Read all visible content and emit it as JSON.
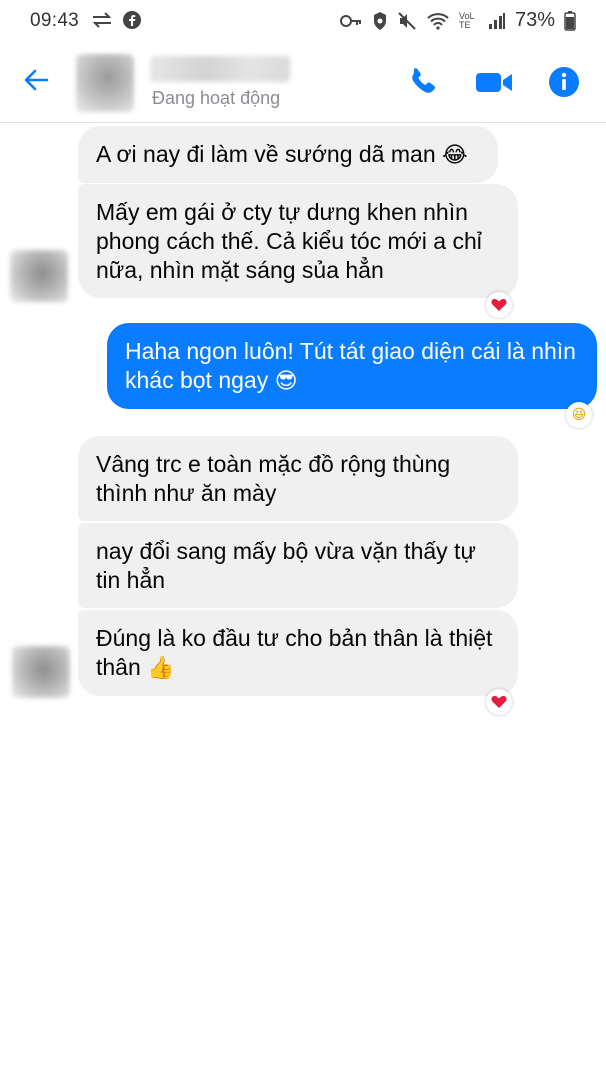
{
  "status_bar": {
    "time": "09:43",
    "battery": "73%",
    "network": "VoLTE",
    "icons": [
      "data-transfer-icon",
      "facebook-icon",
      "key-icon",
      "security-icon",
      "mute-icon",
      "wifi-icon",
      "signal-icon",
      "battery-icon"
    ]
  },
  "header": {
    "name": "",
    "status": "Đang hoạt động",
    "icons": [
      "back-arrow-icon",
      "phone-icon",
      "video-icon",
      "info-icon"
    ],
    "accent_color": "#0a7cff"
  },
  "messages": [
    {
      "side": "in",
      "text": "A ơi nay đi làm về sướng dã man",
      "emoji": "😂"
    },
    {
      "side": "in",
      "text": "Mấy em gái ở cty tự dưng khen nhìn phong cách thế. Cả kiểu tóc mới a chỉ nữa, nhìn mặt sáng sủa hẳn",
      "reaction": "❤"
    },
    {
      "side": "out",
      "text": "Haha ngon luôn! Tút tát giao diện cái là nhìn khác bọt ngay",
      "emoji": "😎",
      "reaction": "😆"
    },
    {
      "side": "in",
      "text": "Vâng trc e toàn mặc đồ rộng thùng thình như ăn mày"
    },
    {
      "side": "in",
      "text": "nay đổi sang mấy bộ vừa vặn thấy tự tin hẳn"
    },
    {
      "side": "in",
      "text": "Đúng là ko đầu tư cho bản thân là thiệt thân",
      "emoji": "👍",
      "reaction": "❤"
    }
  ],
  "colors": {
    "incoming_bubble": "#f0f0f0",
    "outgoing_bubble": "#0a7cff",
    "heart": "#e41e3f"
  }
}
